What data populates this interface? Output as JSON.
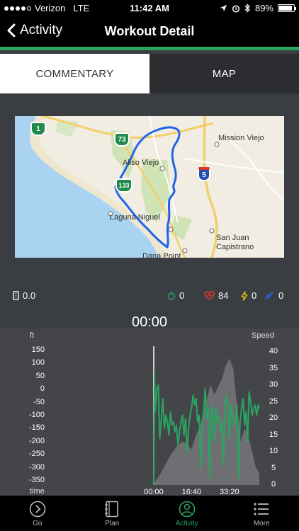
{
  "status_bar": {
    "carrier": "Verizon",
    "network": "LTE",
    "time": "11:42 AM",
    "battery": "89%",
    "battery_level": 0.89
  },
  "nav": {
    "back_label": "Activity",
    "title": "Workout Detail"
  },
  "tabs": [
    {
      "label": "COMMENTARY",
      "active": true
    },
    {
      "label": "MAP",
      "active": false
    }
  ],
  "map": {
    "labels": [
      "Mission Viejo",
      "Aliso Viejo",
      "Laguna Niguel",
      "San Juan",
      "Capistrano",
      "Dana Point"
    ],
    "shields": [
      "1",
      "73",
      "133",
      "5"
    ],
    "route_color": "#1f64e8"
  },
  "stats": {
    "distance": "0.0",
    "duration": "0",
    "heart_rate": "84",
    "power": "0",
    "cadence": "0"
  },
  "elapsed_time": "00:00",
  "chart_data": {
    "type": "line",
    "left_axis_label": "ft",
    "right_axis_label": "Speed",
    "x_axis_label": "time",
    "y_left_ticks": [
      "150",
      "100",
      "50",
      "0",
      "-50",
      "-100",
      "-150",
      "-200",
      "-250",
      "-300",
      "-350"
    ],
    "y_right_ticks": [
      "40",
      "35",
      "30",
      "25",
      "20",
      "15",
      "10",
      "5",
      "0"
    ],
    "x_ticks": [
      "00:00",
      "16:40",
      "33:20"
    ],
    "x_tick_values": [
      0,
      1000,
      2000
    ],
    "xlim": [
      0,
      2790
    ],
    "ylim_left": [
      -350,
      150
    ],
    "ylim_right": [
      0,
      40
    ],
    "series": [
      {
        "axis": "left",
        "color": "#6e6f72",
        "x": [
          0,
          150,
          300,
          450,
          600,
          750,
          900,
          1000,
          1100,
          1200,
          1300,
          1400,
          1500,
          1600,
          1700,
          1800,
          1900,
          2000,
          2100,
          2200,
          2300,
          2400,
          2500,
          2600,
          2700,
          2790
        ],
        "y": [
          -360,
          -330,
          -290,
          -250,
          -220,
          -200,
          -210,
          -230,
          -180,
          -150,
          -100,
          -40,
          20,
          -20,
          10,
          40,
          90,
          120,
          80,
          -60,
          -200,
          -150,
          -180,
          -240,
          -300,
          -320
        ]
      },
      {
        "axis": "right",
        "color": "#2aa561",
        "x": [
          0,
          20,
          40,
          80,
          120,
          160,
          200,
          240,
          280,
          320,
          360,
          400,
          440,
          480,
          520,
          560,
          600,
          640,
          680,
          720,
          760,
          800,
          840,
          880,
          920,
          960,
          1000,
          1040,
          1080,
          1120,
          1160,
          1200,
          1240,
          1280,
          1320,
          1360,
          1400,
          1440,
          1480,
          1520,
          1560,
          1600,
          1640,
          1680,
          1720,
          1760,
          1800,
          1840,
          1880,
          1920,
          1960,
          2000,
          2040,
          2080,
          2120,
          2160,
          2200,
          2240,
          2280,
          2320,
          2360,
          2400,
          2440,
          2480,
          2520,
          2560,
          2600,
          2640,
          2680,
          2720,
          2760,
          2790
        ],
        "y": [
          0,
          34,
          22,
          29,
          30,
          14,
          20,
          26,
          17,
          21,
          19,
          15,
          22,
          18,
          19,
          16,
          18,
          12,
          16,
          19,
          21,
          15,
          20,
          10,
          17,
          21,
          23,
          27,
          24,
          26,
          19,
          21,
          5,
          19,
          22,
          29,
          20,
          23,
          2,
          21,
          24,
          13,
          23,
          19,
          21,
          16,
          19,
          6,
          23,
          27,
          24,
          14,
          24,
          21,
          18,
          19,
          24,
          2,
          19,
          23,
          26,
          18,
          22,
          13,
          28,
          25,
          21,
          23,
          24,
          21,
          24,
          23
        ]
      }
    ]
  },
  "tab_bar": [
    {
      "label": "Go",
      "icon": "go-circle-icon",
      "active": false
    },
    {
      "label": "Plan",
      "icon": "notebook-icon",
      "active": false
    },
    {
      "label": "Activity",
      "icon": "activity-person-icon",
      "active": true
    },
    {
      "label": "More",
      "icon": "more-list-icon",
      "active": false
    }
  ],
  "colors": {
    "accent": "#2aa561",
    "heart": "#e53935",
    "power": "#f5c518",
    "cadence": "#1f64e8"
  }
}
